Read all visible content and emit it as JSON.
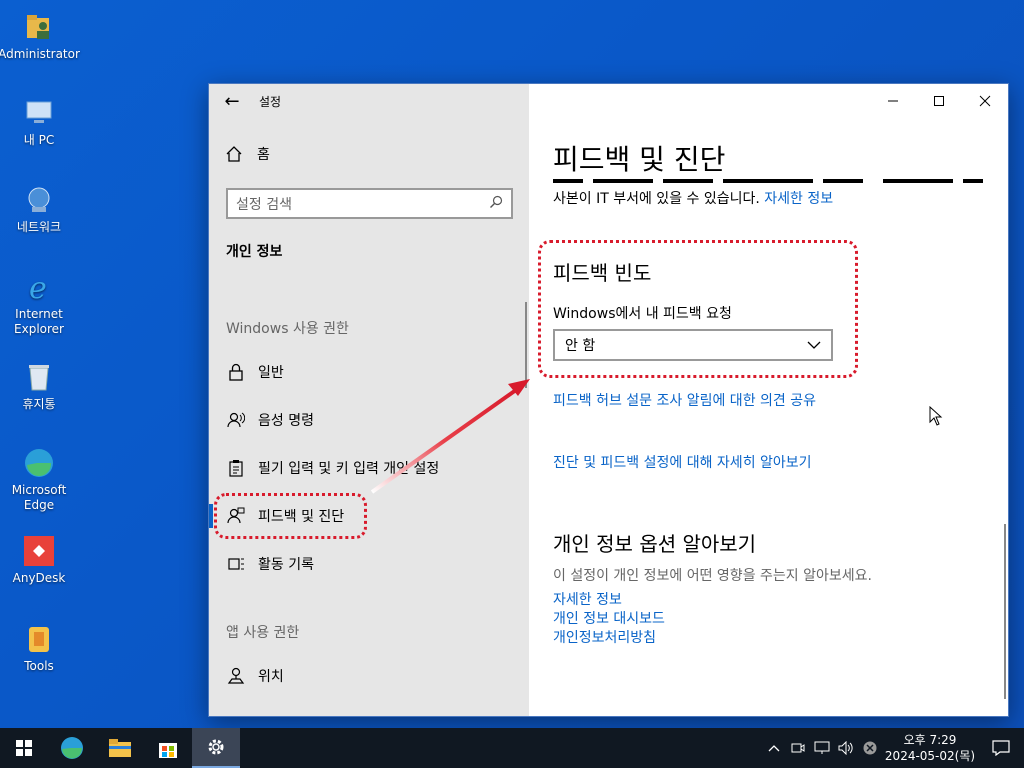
{
  "desktop": {
    "icons": [
      {
        "label": "Administrator",
        "icon": "user-folder-icon"
      },
      {
        "label": "내 PC",
        "icon": "computer-icon"
      },
      {
        "label": "네트워크",
        "icon": "network-icon"
      },
      {
        "label": "Internet Explorer",
        "icon": "internet-explorer-icon"
      },
      {
        "label": "휴지통",
        "icon": "recycle-bin-icon"
      },
      {
        "label": "Microsoft Edge",
        "icon": "edge-icon"
      },
      {
        "label": "AnyDesk",
        "icon": "anydesk-icon"
      },
      {
        "label": "Tools",
        "icon": "tools-icon"
      }
    ]
  },
  "window": {
    "title": "설정",
    "controls": {
      "minimize": "minimize-icon",
      "maximize": "maximize-icon",
      "close": "close-icon"
    }
  },
  "sidebar": {
    "home_label": "홈",
    "search_placeholder": "설정 검색",
    "section_title": "개인 정보",
    "group_windows": "Windows 사용 권한",
    "items": [
      {
        "label": "일반",
        "icon": "lock-icon"
      },
      {
        "label": "음성 명령",
        "icon": "speech-icon"
      },
      {
        "label": "필기 입력 및 키 입력 개인 설정",
        "icon": "clipboard-pen-icon"
      },
      {
        "label": "피드백 및 진단",
        "icon": "feedback-icon"
      },
      {
        "label": "활동 기록",
        "icon": "activity-history-icon"
      }
    ],
    "group_apps": "앱 사용 권한",
    "app_items": [
      {
        "label": "위치",
        "icon": "location-icon"
      }
    ],
    "selected_index": 3
  },
  "main": {
    "page_title": "피드백 및 진단",
    "intro_text": "사본이 IT 부서에 있을 수 있습니다.",
    "intro_link": "자세한 정보",
    "feedback_frequency_heading": "피드백 빈도",
    "dropdown_label": "Windows에서 내 피드백 요청",
    "dropdown_value": "안 함",
    "link_share_opinion": "피드백 허브 설문 조사 알림에 대한 의견 공유",
    "link_learn_more": "진단 및 피드백 설정에 대해 자세히 알아보기",
    "privacy_heading": "개인 정보 옵션 알아보기",
    "privacy_note": "이 설정이 개인 정보에 어떤 영향을 주는지 알아보세요.",
    "privacy_links": [
      "자세한 정보",
      "개인 정보 대시보드",
      "개인정보처리방침"
    ]
  },
  "taskbar": {
    "clock_time": "오후 7:29",
    "clock_date": "2024-05-02(목)"
  },
  "colors": {
    "accent": "#0a64c8",
    "annotation": "#d81b2c"
  }
}
